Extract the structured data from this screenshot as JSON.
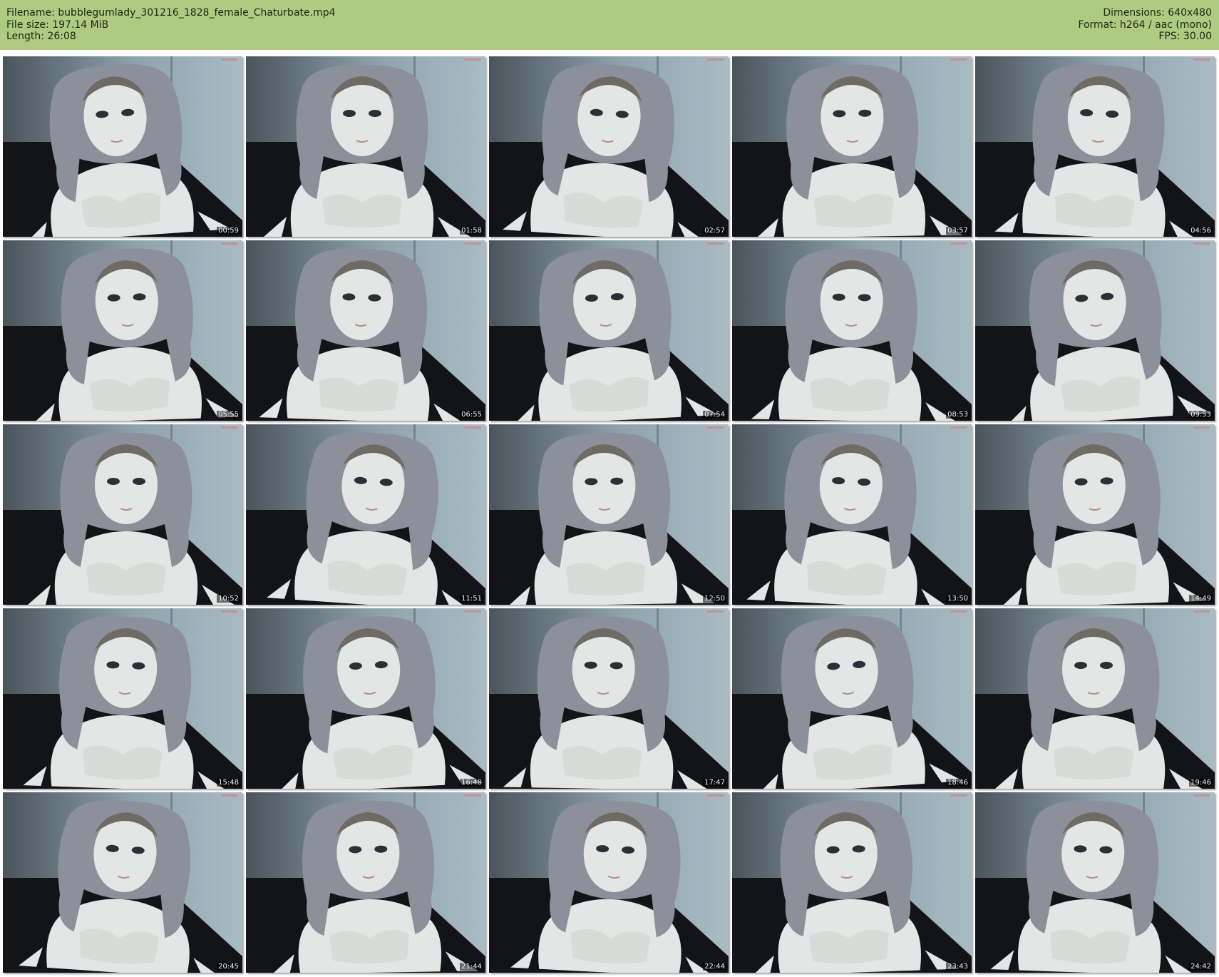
{
  "header": {
    "left": [
      "Filename: bubblegumlady_301216_1828_female_Chaturbate.mp4",
      "File size: 197.14 MiB",
      "Length: 26:08"
    ],
    "right": [
      "Dimensions: 640x480",
      "Format: h264 / aac (mono)",
      "FPS: 30.00"
    ]
  },
  "thumbnails": [
    {
      "time": "00:59"
    },
    {
      "time": "01:58"
    },
    {
      "time": "02:57"
    },
    {
      "time": "03:57"
    },
    {
      "time": "04:56"
    },
    {
      "time": "05:55"
    },
    {
      "time": "06:55"
    },
    {
      "time": "07:54"
    },
    {
      "time": "08:53"
    },
    {
      "time": "09:53"
    },
    {
      "time": "10:52"
    },
    {
      "time": "11:51"
    },
    {
      "time": "12:50"
    },
    {
      "time": "13:50"
    },
    {
      "time": "14:49"
    },
    {
      "time": "15:48"
    },
    {
      "time": "16:48"
    },
    {
      "time": "17:47"
    },
    {
      "time": "18:46"
    },
    {
      "time": "19:46"
    },
    {
      "time": "20:45"
    },
    {
      "time": "21:44"
    },
    {
      "time": "22:44"
    },
    {
      "time": "23:43"
    },
    {
      "time": "24:42"
    }
  ],
  "colors": {
    "header_bg": "#afcb82",
    "wall": "#8fa3ac",
    "sofa": "#121418",
    "skin": "#e3e6e4",
    "hair": "#8c909a",
    "bra": "#d9dbd8"
  }
}
